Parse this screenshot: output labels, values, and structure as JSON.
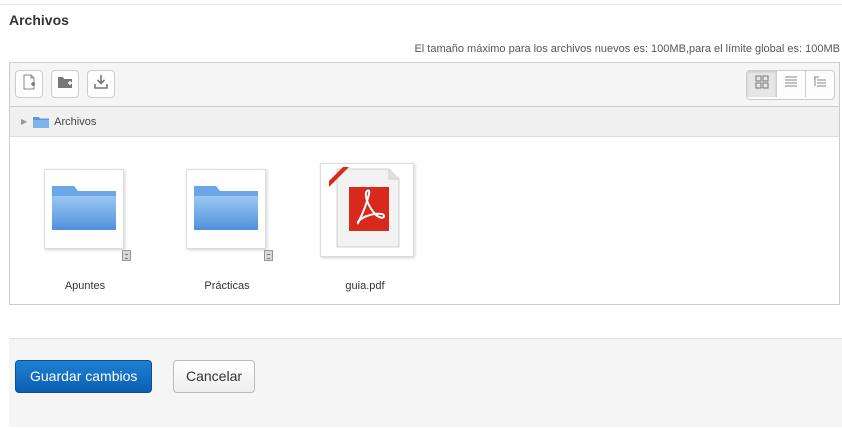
{
  "section": {
    "title": "Archivos",
    "size_note": "El tamaño máximo para los archivos nuevos es: 100MB,para el límite global es: 100MB"
  },
  "toolbar": {
    "buttons": [
      {
        "icon": "add-file-icon"
      },
      {
        "icon": "create-folder-icon"
      },
      {
        "icon": "download-icon"
      }
    ],
    "view_modes": [
      {
        "icon": "grid-view-icon",
        "active": true
      },
      {
        "icon": "list-view-icon",
        "active": false
      },
      {
        "icon": "tree-view-icon",
        "active": false
      }
    ]
  },
  "path": {
    "label": "Archivos"
  },
  "items": [
    {
      "label": "Apuntes",
      "type": "folder"
    },
    {
      "label": "Prácticas",
      "type": "folder"
    },
    {
      "label": "guia.pdf",
      "type": "pdf"
    }
  ],
  "actions": {
    "save_label": "Guardar cambios",
    "cancel_label": "Cancelar"
  },
  "colors": {
    "primary_button": "#0f6fc5",
    "folder_blue": "#6aa6e8",
    "pdf_red": "#d9291c"
  }
}
